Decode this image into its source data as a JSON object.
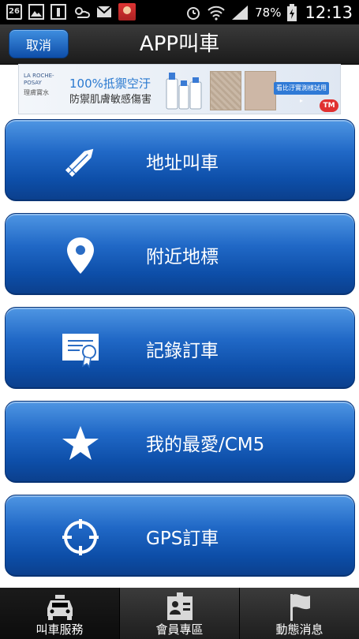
{
  "status_bar": {
    "date_icon_text": "26",
    "battery_percent": "78%",
    "time": "12:13"
  },
  "header": {
    "cancel_label": "取消",
    "title": "APP叫車"
  },
  "ad": {
    "brand": "LA ROCHE-POSAY",
    "brand_sub": "理膚寶水",
    "line1": "100%抵禦空汙",
    "line2": "防禦肌膚敏感傷害",
    "cta": "看比汙實測樣試用 ▸",
    "badge": "TM"
  },
  "menu": [
    {
      "label": "地址叫車",
      "icon": "pencil-icon"
    },
    {
      "label": "附近地標",
      "icon": "location-pin-icon"
    },
    {
      "label": "記錄訂車",
      "icon": "certificate-icon"
    },
    {
      "label": "我的最愛/CM5",
      "icon": "star-icon"
    },
    {
      "label": "GPS訂車",
      "icon": "crosshair-icon"
    }
  ],
  "tabs": [
    {
      "label": "叫車服務",
      "icon": "taxi-icon",
      "active": true
    },
    {
      "label": "會員專區",
      "icon": "member-card-icon",
      "active": false
    },
    {
      "label": "動態消息",
      "icon": "flag-icon",
      "active": false
    }
  ],
  "colors": {
    "button_top": "#4f96e3",
    "button_bottom": "#0b3f8c",
    "title_bar": "#1b1b1b"
  }
}
